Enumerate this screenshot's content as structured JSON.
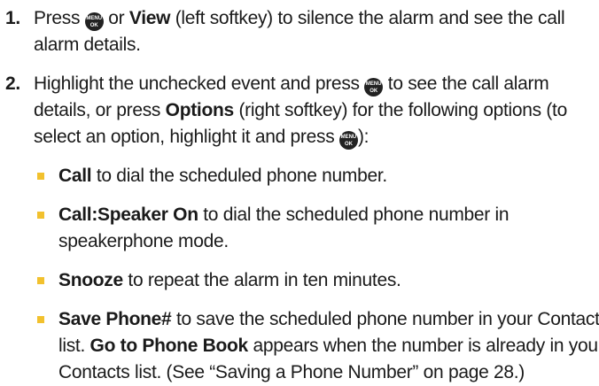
{
  "icons": {
    "menu_ok": "menu-ok-key-icon",
    "bullet": "yellow-square-bullet"
  },
  "steps": [
    {
      "number": "1.",
      "parts": [
        "Press ",
        " or ",
        "View",
        " (left softkey) to silence the alarm and see the call alarm details."
      ]
    },
    {
      "number": "2.",
      "parts": [
        "Highlight the unchecked event and press ",
        " to see the call alarm details, or press ",
        "Options",
        " (right softkey) for the following options (to select an option, highlight it and press ",
        "):"
      ]
    }
  ],
  "options": [
    {
      "label": "Call",
      "text": " to dial the scheduled phone number."
    },
    {
      "label": "Call:Speaker On",
      "text": " to dial the scheduled phone number in speakerphone mode."
    },
    {
      "label": "Snooze",
      "text": " to repeat the alarm in ten minutes."
    },
    {
      "label": "Save Phone#",
      "text": " to save the scheduled phone number in your Contacts list. ",
      "label2": "Go to Phone Book",
      "text2": " appears when the number is already in your Contacts list. (See “Saving a Phone Number” on page 28.)"
    }
  ],
  "colors": {
    "bullet": "#f2c12e",
    "text": "#1a1a1a"
  }
}
